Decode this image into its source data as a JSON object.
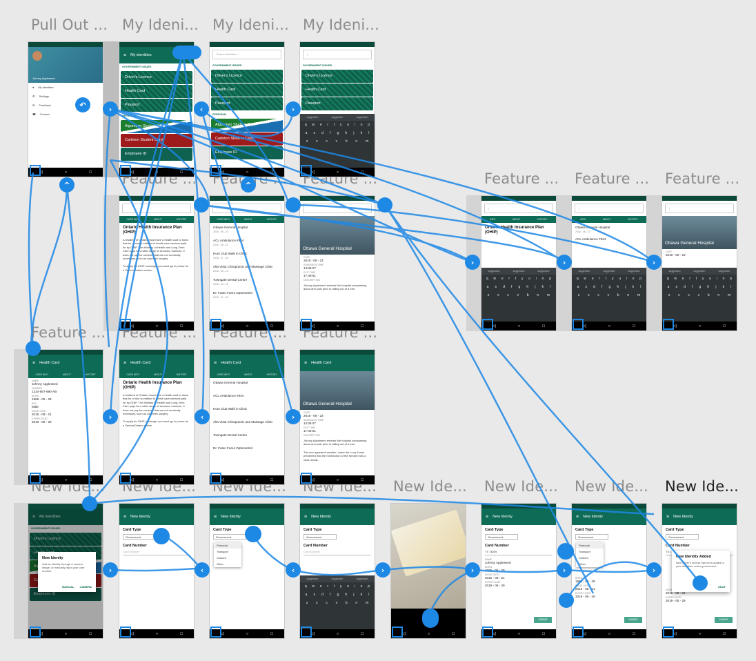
{
  "titles": {
    "r1c1": "Pull Out ...",
    "r1c2": "My Ideni...",
    "r1c3": "My Ideni...",
    "r1c4": "My Ideni...",
    "r2c1": "Feature ...",
    "r2c5": "Feature ...",
    "r2c6": "Feature ...",
    "r2c7": "Feature ...",
    "r3c1": "Feature ...",
    "r3c2": "Feature ...",
    "r3c3": "Feature ...",
    "r3c4": "Feature ...",
    "r4c1": "New Ide...",
    "r4c2": "New Ide...",
    "r4c3": "New Ide...",
    "r4c4": "New Ide...",
    "r4c5": "New Ide...",
    "r4c6": "New Ide...",
    "r4c7": "New Ide...",
    "r4c8": "New Ide..."
  },
  "drawer": {
    "user": "Johnny Appleseed",
    "items": [
      "My identities",
      "Settings",
      "Feedback",
      "Contact"
    ]
  },
  "identities": {
    "appbar": "My identities",
    "section_gov": "GOVERNMENT ISSUED",
    "section_personal": "PERSONAL",
    "cards": [
      "Driver's Licence",
      "Health Card",
      "Passport",
      "Algonquin Student Card",
      "Carleton Student Card",
      "Employee ID"
    ],
    "search_placeholder": "Search identities"
  },
  "keyboard": {
    "suggestions": [
      "suggestion",
      "suggestion",
      "suggestion"
    ],
    "row1": [
      "q",
      "w",
      "e",
      "r",
      "t",
      "y",
      "u",
      "i",
      "o",
      "p"
    ],
    "row2": [
      "a",
      "s",
      "d",
      "f",
      "g",
      "h",
      "j",
      "k",
      "l"
    ],
    "row3": [
      "z",
      "x",
      "c",
      "v",
      "b",
      "n",
      "m"
    ]
  },
  "feature": {
    "tabs": [
      "CARD INFO",
      "ABOUT",
      "HISTORY"
    ],
    "tabs_alt": [
      "INFO",
      "ABOUT",
      "HISTORY"
    ],
    "plan_title": "Ontario Health Insurance Plan (OHIP)",
    "plan_text": "A resident of Ontario must have a health card to show that he or she is entitled to health care services paid for by OHIP. The Ministry of Health and Long-Term Care pays for a wide range of services, however, it does not pay for services that are not medically necessary, such as cosmetic surgery.",
    "plan_text2": "To apply for OHIP coverage, you must go in person to a ServiceOntario centre.",
    "history": [
      {
        "name": "Ottawa General Hospital",
        "date": "2016 - 08 - 23"
      },
      {
        "name": "ACL Ambulance #534",
        "date": "2016 - 08 - 21"
      },
      {
        "name": "Hunt Club Walk in Clinic",
        "date": "2016 - 07 - 09"
      },
      {
        "name": "Alta Vista Chiropractic and Massage Clinic",
        "date": "2016 - 05 - 12"
      },
      {
        "name": "Towngate Dental Centre",
        "date": "2016 - 03 - 18"
      },
      {
        "name": "Dr. Faten Fares Optometrist",
        "date": "2016 - 01 - 03"
      }
    ],
    "hospital": "Ottawa General Hospital",
    "date_label": "DATE",
    "date": "2016 - 08 - 23",
    "admit_label": "ADMISSION TIME",
    "admit": "14:36 07",
    "exit_label": "EXIT TIME",
    "exit": "17:49 51",
    "desc_label": "DESCRIPTION",
    "desc": "Johnny Appleseed entered the hospital complaining about arm pain prior to falling out of a tree.",
    "desc2": "The arm appeared swollen, under the x-ray it was presented that the misfunction of the forearm has a clean break.",
    "health_card": "Health Card",
    "name_label": "NAME",
    "name": "Johnny Appleseed",
    "number_label": "NUMBER",
    "number": "1234-567-890-AB",
    "born_label": "BORN",
    "born": "1966 - 05 - 29",
    "sex_label": "SEX",
    "sex": "Male",
    "issue_label": "ISSUE DATE",
    "issue": "2015 - 08 - 21",
    "expiry_label": "EXPIRY DATE",
    "expiry": "2019 - 05 - 29"
  },
  "new_identity": {
    "appbar": "New Idenity",
    "card_type": "Card Type",
    "type_value": "Government",
    "card_number": "Card Number",
    "number_placeholder": "Card Number",
    "number_value": "TX 78209",
    "options": [
      "Personal",
      "Transport",
      "Custom",
      "Other"
    ],
    "dialog_title": "New Idenity",
    "dialog_text": "Add an identity through a camera image, or manually input your card number.",
    "dialog_btn1": "MANUAL",
    "dialog_btn2": "CAMERA",
    "added_title": "New Identity Added",
    "added_text": "New driver's license has been added to your identities under government.",
    "added_btn": "OKAY",
    "submit": "SUBMIT",
    "camera_icon": "camera-icon"
  },
  "colors": {
    "brand": "#0e6b55",
    "hotspot": "#1e88e5",
    "link": "#1e88e5"
  }
}
